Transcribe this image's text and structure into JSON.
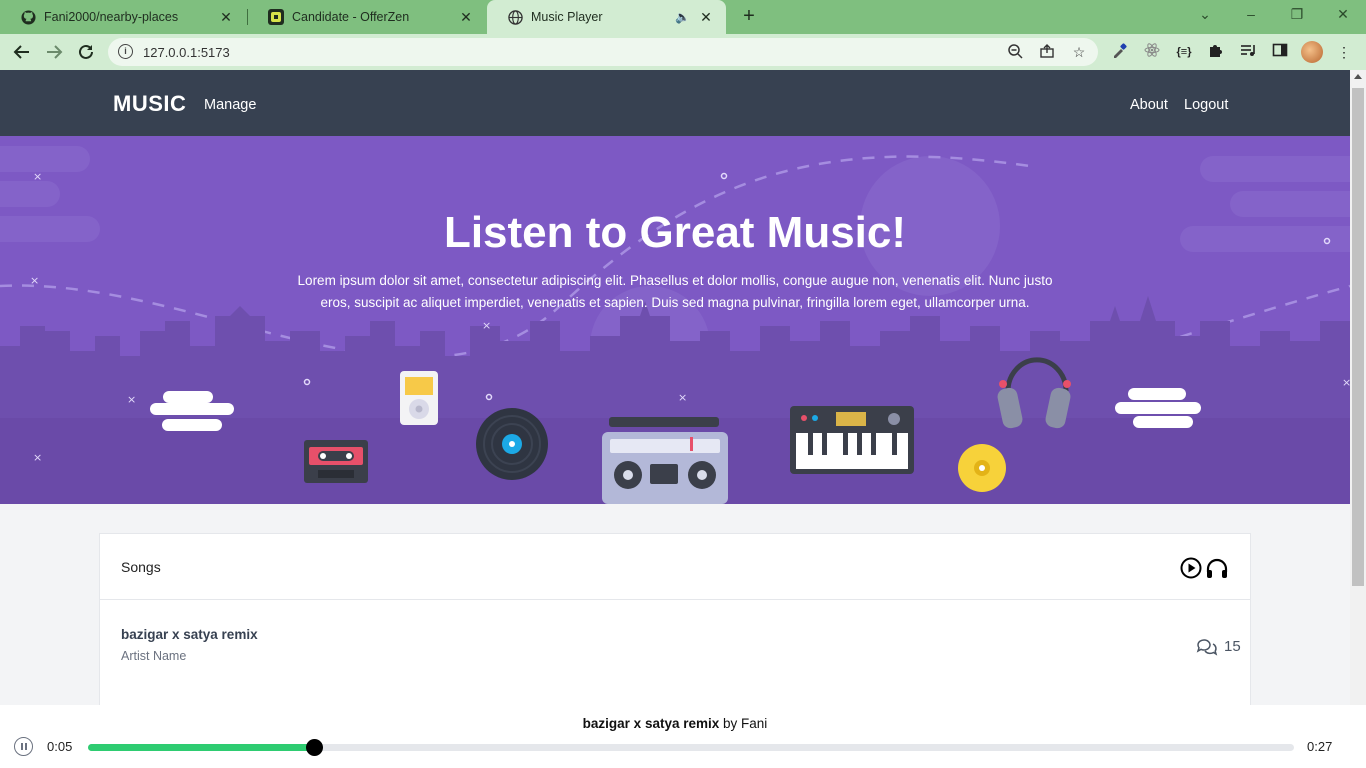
{
  "browser": {
    "tabs": [
      {
        "title": "Fani2000/nearby-places"
      },
      {
        "title": "Candidate - OfferZen"
      },
      {
        "title": "Music Player"
      }
    ],
    "url": "127.0.0.1:5173"
  },
  "header": {
    "brand": "MUSIC",
    "manage": "Manage",
    "about": "About",
    "logout": "Logout"
  },
  "hero": {
    "title": "Listen to Great Music!",
    "text": "Lorem ipsum dolor sit amet, consectetur adipiscing elit. Phasellus et dolor mollis, congue augue non, venenatis elit. Nunc justo eros, suscipit ac aliquet imperdiet, venenatis et sapien. Duis sed magna pulvinar, fringilla lorem eget, ullamcorper urna."
  },
  "songs": {
    "heading": "Songs",
    "items": [
      {
        "title": "bazigar x satya remix",
        "artist": "Artist Name",
        "comments": "15"
      }
    ]
  },
  "player": {
    "song_title": "bazigar x satya remix",
    "by": "by",
    "artist": "Fani",
    "current_time": "0:05",
    "duration": "0:27",
    "progress": 0.187
  },
  "colors": {
    "header_bg": "#374151",
    "hero_bg": "#7d59c4",
    "progress_fill": "#2ecc71",
    "browser_frame": "#7fbf7f"
  }
}
